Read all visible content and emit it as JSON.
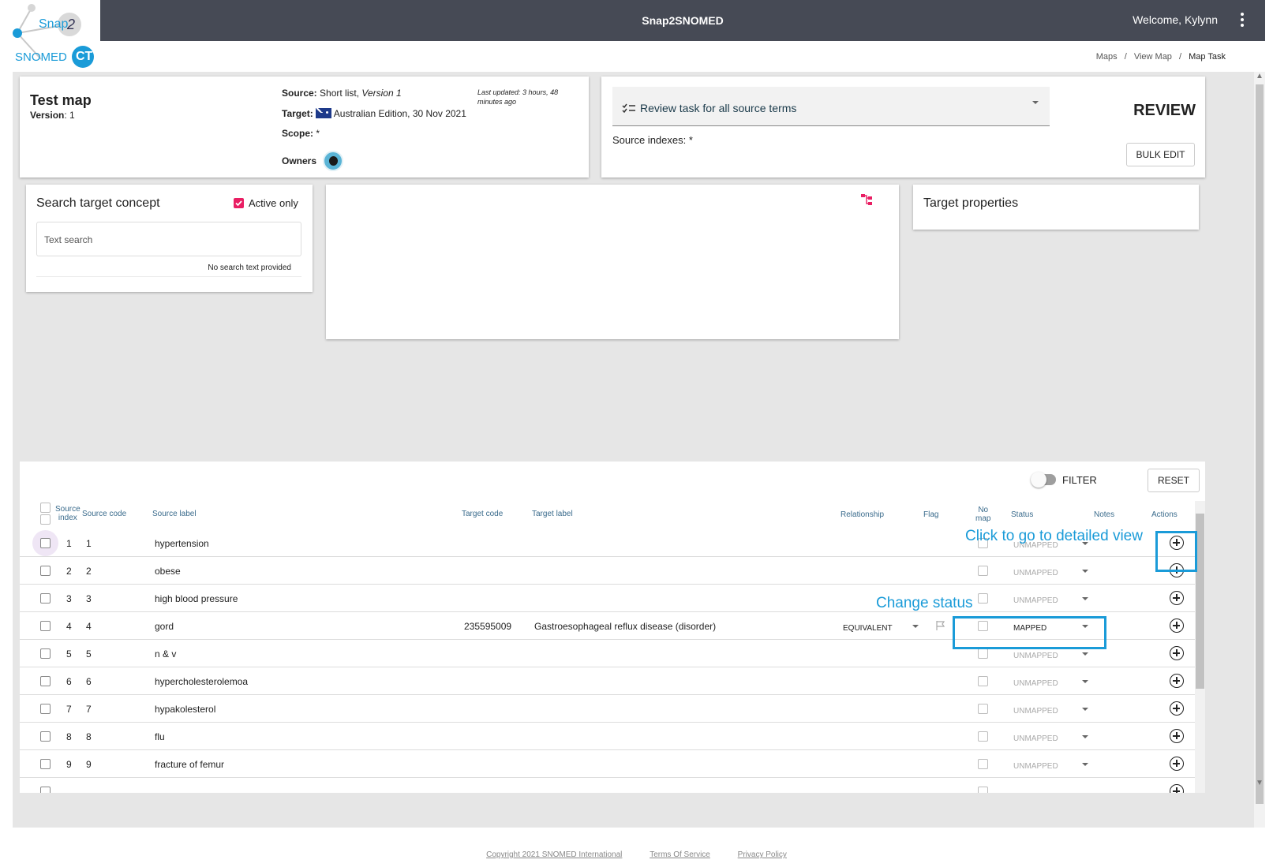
{
  "logo": {
    "snap": "Snap",
    "two": "2",
    "snomed": "SNOMED",
    "ct": "CT"
  },
  "topbar": {
    "title": "Snap2SNOMED",
    "welcome": "Welcome, Kylynn"
  },
  "breadcrumb": {
    "maps": "Maps",
    "sep": "/",
    "view_map": "View Map",
    "current": "Map Task"
  },
  "map_info": {
    "name": "Test map",
    "version_label": "Version",
    "version_value": ": 1",
    "source_label": "Source:",
    "source_value": "Short list,",
    "source_version": "Version 1",
    "last_updated": "Last updated: 3 hours, 48 minutes ago",
    "target_label": "Target:",
    "target_value": "Australian Edition, 30 Nov 2021",
    "scope_label": "Scope:",
    "scope_value": "*",
    "owners_label": "Owners"
  },
  "task": {
    "selected": "Review task for all source terms",
    "source_indexes": "Source indexes: *",
    "type": "REVIEW",
    "bulk_edit": "BULK EDIT"
  },
  "search": {
    "title": "Search target concept",
    "active_only": "Active only",
    "placeholder": "Text search",
    "hint": "No search text provided"
  },
  "target_props": {
    "title": "Target properties"
  },
  "table": {
    "filter_label": "FILTER",
    "reset": "RESET",
    "headers": {
      "source_index_1": "Source",
      "source_index_2": "index",
      "source_code": "Source code",
      "source_label": "Source label",
      "target_code": "Target code",
      "target_label": "Target label",
      "relationship": "Relationship",
      "flag": "Flag",
      "no_map_1": "No",
      "no_map_2": "map",
      "status": "Status",
      "notes": "Notes",
      "actions": "Actions"
    },
    "rows": [
      {
        "index": "1",
        "code": "1",
        "label": "hypertension",
        "target_code": "",
        "target_label": "",
        "relationship": "",
        "status": "UNMAPPED"
      },
      {
        "index": "2",
        "code": "2",
        "label": "obese",
        "target_code": "",
        "target_label": "",
        "relationship": "",
        "status": "UNMAPPED"
      },
      {
        "index": "3",
        "code": "3",
        "label": "high blood pressure",
        "target_code": "",
        "target_label": "",
        "relationship": "",
        "status": "UNMAPPED"
      },
      {
        "index": "4",
        "code": "4",
        "label": "gord",
        "target_code": "235595009",
        "target_label": "Gastroesophageal reflux disease (disorder)",
        "relationship": "EQUIVALENT",
        "status": "MAPPED"
      },
      {
        "index": "5",
        "code": "5",
        "label": "n & v",
        "target_code": "",
        "target_label": "",
        "relationship": "",
        "status": "UNMAPPED"
      },
      {
        "index": "6",
        "code": "6",
        "label": "hypercholesterolemoa",
        "target_code": "",
        "target_label": "",
        "relationship": "",
        "status": "UNMAPPED"
      },
      {
        "index": "7",
        "code": "7",
        "label": "hypakolesterol",
        "target_code": "",
        "target_label": "",
        "relationship": "",
        "status": "UNMAPPED"
      },
      {
        "index": "8",
        "code": "8",
        "label": "flu",
        "target_code": "",
        "target_label": "",
        "relationship": "",
        "status": "UNMAPPED"
      },
      {
        "index": "9",
        "code": "9",
        "label": "fracture of femur",
        "target_code": "",
        "target_label": "",
        "relationship": "",
        "status": "UNMAPPED"
      }
    ]
  },
  "annotations": {
    "detailed_view": "Click to go to detailed view",
    "change_status": "Change status",
    "color": "#1a9bd8"
  },
  "footer": {
    "copyright": "Copyright 2021 SNOMED International",
    "terms": "Terms Of Service",
    "privacy": "Privacy Policy"
  },
  "colors": {
    "topbar": "#464a55",
    "accent_pink": "#e91e63",
    "snomed_blue": "#1a9bd8"
  }
}
